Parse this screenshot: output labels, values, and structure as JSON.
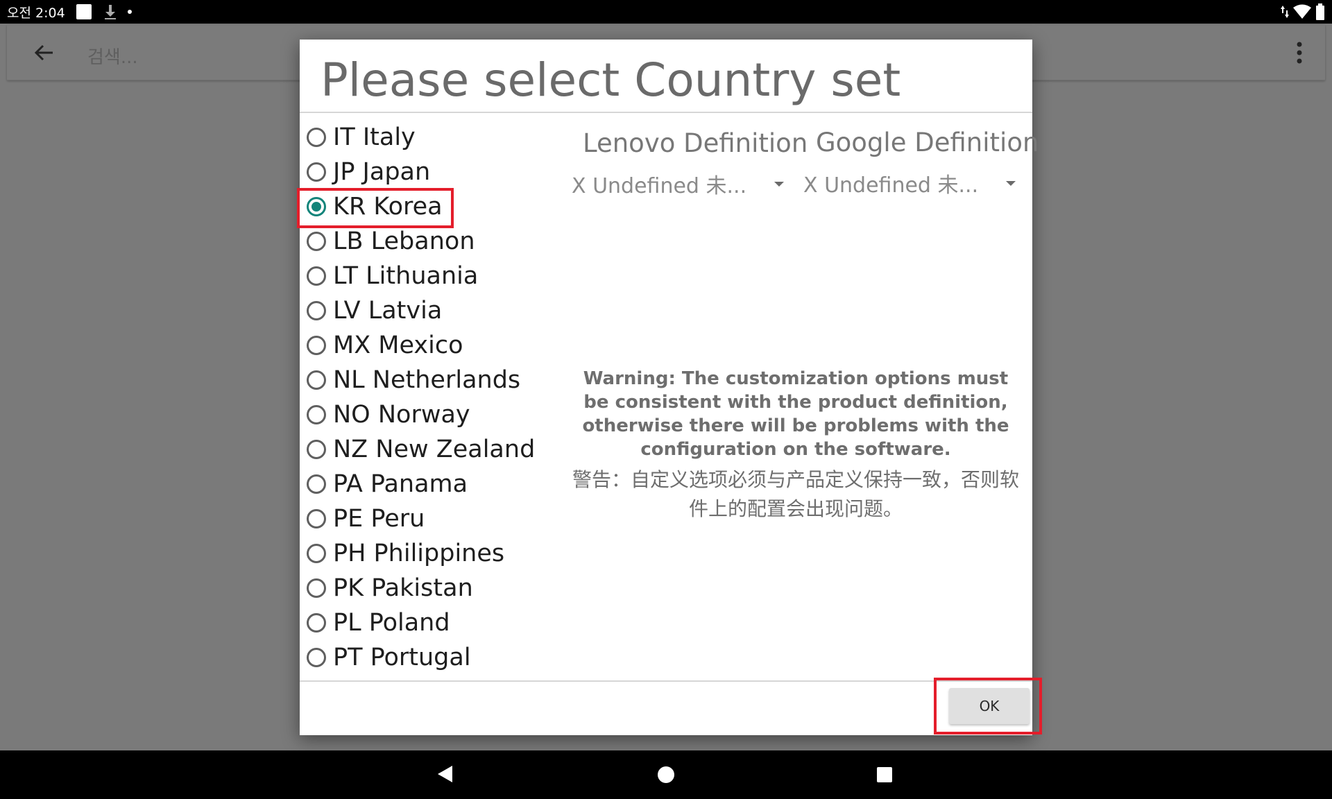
{
  "status_bar": {
    "time": "오전 2:04"
  },
  "search_bar": {
    "placeholder": "검색..."
  },
  "dialog": {
    "title": "Please select Country set",
    "countries": [
      {
        "label": "IT Italy",
        "selected": false
      },
      {
        "label": "JP Japan",
        "selected": false
      },
      {
        "label": "KR Korea",
        "selected": true
      },
      {
        "label": "LB Lebanon",
        "selected": false
      },
      {
        "label": "LT Lithuania",
        "selected": false
      },
      {
        "label": "LV Latvia",
        "selected": false
      },
      {
        "label": "MX Mexico",
        "selected": false
      },
      {
        "label": "NL Netherlands",
        "selected": false
      },
      {
        "label": "NO Norway",
        "selected": false
      },
      {
        "label": "NZ New Zealand",
        "selected": false
      },
      {
        "label": "PA Panama",
        "selected": false
      },
      {
        "label": "PE Peru",
        "selected": false
      },
      {
        "label": "PH Philippines",
        "selected": false
      },
      {
        "label": "PK Pakistan",
        "selected": false
      },
      {
        "label": "PL Poland",
        "selected": false
      },
      {
        "label": "PT Portugal",
        "selected": false
      }
    ],
    "lenovo_definition": {
      "header": "Lenovo Definition",
      "selected": "X Undefined 未..."
    },
    "google_definition": {
      "header": "Google Definition",
      "selected": "X Undefined 未..."
    },
    "warning_en": "Warning: The customization options must be consistent with the product definition, otherwise there will be problems with the configuration on the software.",
    "warning_cn": "警告：自定义选项必须与产品定义保持一致，否则软件上的配置会出现问题。",
    "ok_label": "OK"
  },
  "colors": {
    "radio_accent": "#13847a",
    "highlight": "#e41e2b"
  }
}
